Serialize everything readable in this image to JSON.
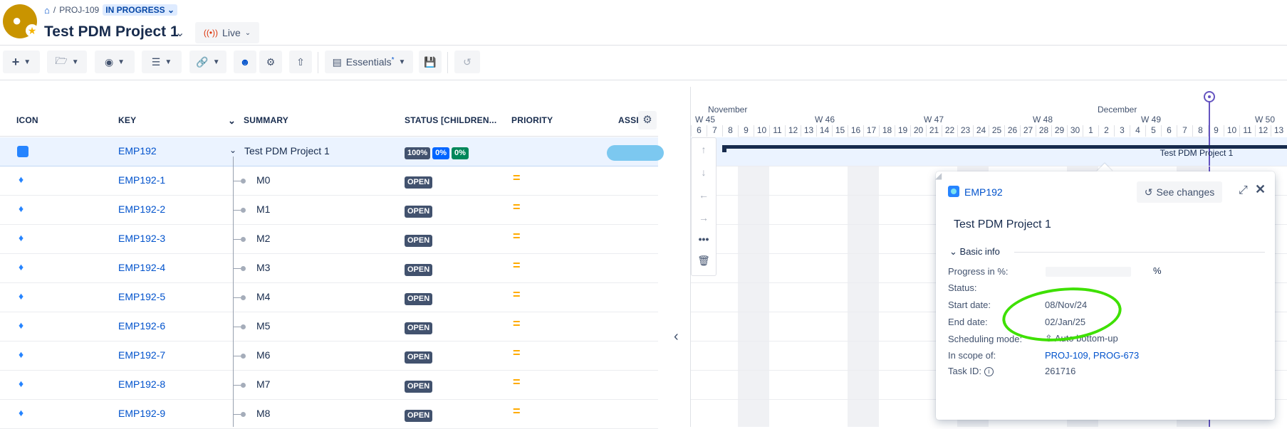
{
  "breadcrumb": {
    "project_key": "PROJ-109",
    "status": "IN PROGRESS"
  },
  "header": {
    "title": "Test PDM Project 1",
    "live_label": "Live"
  },
  "toolbar": {
    "view_label": "Essentials"
  },
  "table": {
    "columns": [
      "ICON",
      "KEY",
      "SUMMARY",
      "STATUS [CHILDREN...",
      "PRIORITY",
      "ASSIG"
    ],
    "parent_row": {
      "key": "EMP192",
      "summary": "Test PDM Project 1",
      "badges": [
        "100%",
        "0%",
        "0%"
      ]
    },
    "rows": [
      {
        "key": "EMP192-1",
        "summary": "M0",
        "status": "OPEN"
      },
      {
        "key": "EMP192-2",
        "summary": "M1",
        "status": "OPEN"
      },
      {
        "key": "EMP192-3",
        "summary": "M2",
        "status": "OPEN"
      },
      {
        "key": "EMP192-4",
        "summary": "M3",
        "status": "OPEN"
      },
      {
        "key": "EMP192-5",
        "summary": "M4",
        "status": "OPEN"
      },
      {
        "key": "EMP192-6",
        "summary": "M5",
        "status": "OPEN"
      },
      {
        "key": "EMP192-7",
        "summary": "M6",
        "status": "OPEN"
      },
      {
        "key": "EMP192-8",
        "summary": "M7",
        "status": "OPEN"
      },
      {
        "key": "EMP192-9",
        "summary": "M8",
        "status": "OPEN"
      }
    ]
  },
  "gantt": {
    "months": [
      "November",
      "December"
    ],
    "weeks": [
      "W 45",
      "W 46",
      "W 47",
      "W 48",
      "W 49",
      "W 50"
    ],
    "days": [
      "6",
      "7",
      "8",
      "9",
      "10",
      "11",
      "12",
      "13",
      "14",
      "15",
      "16",
      "17",
      "18",
      "19",
      "20",
      "21",
      "22",
      "23",
      "24",
      "25",
      "26",
      "27",
      "28",
      "29",
      "30",
      "1",
      "2",
      "3",
      "4",
      "5",
      "6",
      "7",
      "8",
      "9",
      "10",
      "11",
      "12",
      "13"
    ],
    "bar_label": "Test PDM Project 1"
  },
  "popup": {
    "key": "EMP192",
    "see_changes": "See changes",
    "title": "Test PDM Project 1",
    "section": "Basic info",
    "progress_label": "Progress in %:",
    "progress_unit": "%",
    "status_label": "Status:",
    "start_label": "Start date:",
    "start_value": "08/Nov/24",
    "end_label": "End date:",
    "end_value": "02/Jan/25",
    "scheduling_label": "Scheduling mode:",
    "scheduling_value": "Auto bottom-up",
    "scope_label": "In scope of:",
    "scope_value": "PROJ-109, PROG-673",
    "taskid_label": "Task ID:",
    "taskid_value": "261716"
  },
  "colors": {
    "accent": "#0052cc",
    "today": "#6554c0",
    "annotation": "#3ee000",
    "priority": "#ffab00"
  }
}
